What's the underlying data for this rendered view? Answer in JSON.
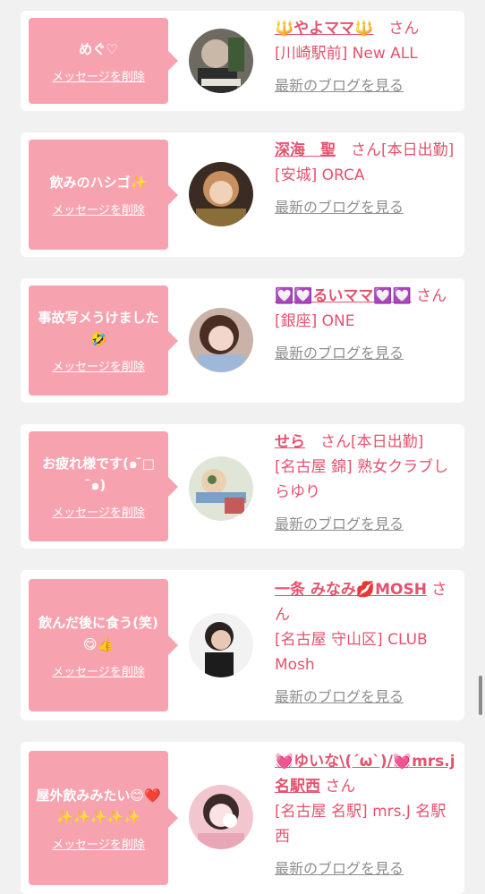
{
  "theme": {
    "bubble": "#f7a3af",
    "accent": "#e5526e",
    "muted": "#8e8e8e"
  },
  "entries": [
    {
      "message": "めぐ♡",
      "delete_label": "メッセージを削除",
      "name": "🔱やよママ🔱",
      "suffix": "さん",
      "location": "[川崎駅前] New ALL",
      "blog_label": "最新のブログを見る"
    },
    {
      "message": "飲みのハシゴ✨",
      "delete_label": "メッセージを削除",
      "name": "深海　聖",
      "suffix": "さん[本日出勤]",
      "location": "[安城] ORCA",
      "blog_label": "最新のブログを見る"
    },
    {
      "message": "事故写メうけました🤣",
      "delete_label": "メッセージを削除",
      "name": "💟💟るいママ💟💟",
      "suffix": "さん",
      "location": "[銀座] ONE",
      "blog_label": "最新のブログを見る"
    },
    {
      "message": "お疲れ様です(๑ ̄□ ̄๑)",
      "delete_label": "メッセージを削除",
      "name": "せら",
      "suffix": "さん[本日出勤]",
      "location": "[名古屋 錦] 熟女クラブしらゆり",
      "blog_label": "最新のブログを見る"
    },
    {
      "message": "飲んだ後に食う(笑)😋👍",
      "delete_label": "メッセージを削除",
      "name": "一条 みなみ💋MOSH",
      "suffix": "さん",
      "location": "[名古屋 守山区] CLUB Mosh",
      "blog_label": "最新のブログを見る"
    },
    {
      "message": "屋外飲みみたい😊❤️✨✨✨✨✨",
      "delete_label": "メッセージを削除",
      "name": "💓ゆいな\\(´ω`)/💓mrs.j名駅西",
      "suffix": "さん",
      "location": "[名古屋 名駅] mrs.J 名駅西",
      "blog_label": "最新のブログを見る"
    }
  ]
}
